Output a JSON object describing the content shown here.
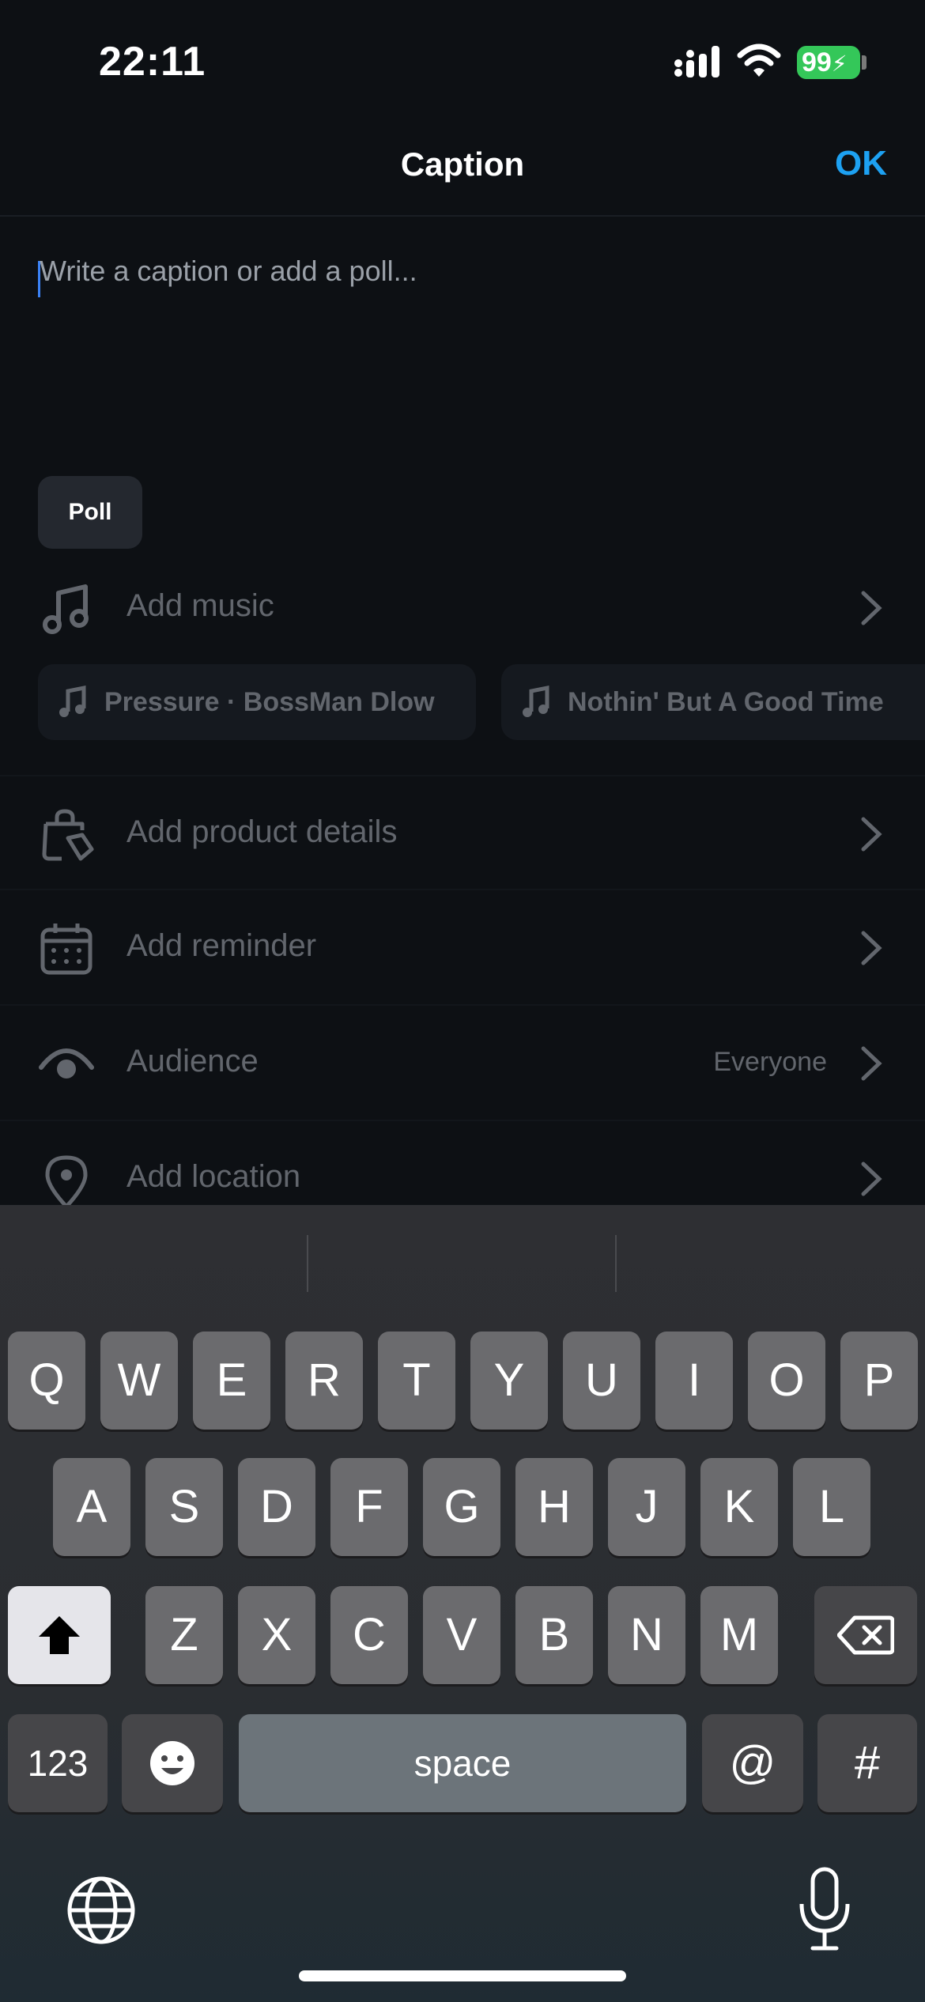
{
  "status_bar": {
    "time": "22:11",
    "battery": "99"
  },
  "header": {
    "title": "Caption",
    "ok_label": "OK"
  },
  "caption_input": {
    "placeholder": "Write a caption or add a poll..."
  },
  "poll_label": "Poll",
  "rows": {
    "music": "Add music",
    "product": "Add product details",
    "reminder": "Add reminder",
    "audience": "Audience",
    "audience_value": "Everyone",
    "location": "Add location"
  },
  "music_suggestions": [
    "Pressure · BossMan Dlow",
    "Nothin' But A Good Time"
  ],
  "keyboard": {
    "row1": [
      "Q",
      "W",
      "E",
      "R",
      "T",
      "Y",
      "U",
      "I",
      "O",
      "P"
    ],
    "row2": [
      "A",
      "S",
      "D",
      "F",
      "G",
      "H",
      "J",
      "K",
      "L"
    ],
    "row3": [
      "Z",
      "X",
      "C",
      "V",
      "B",
      "N",
      "M"
    ],
    "numbers": "123",
    "space": "space",
    "at": "@",
    "hash": "#"
  },
  "colors": {
    "accent": "#1da1f2",
    "battery": "#34c759",
    "background": "#0d1014"
  }
}
